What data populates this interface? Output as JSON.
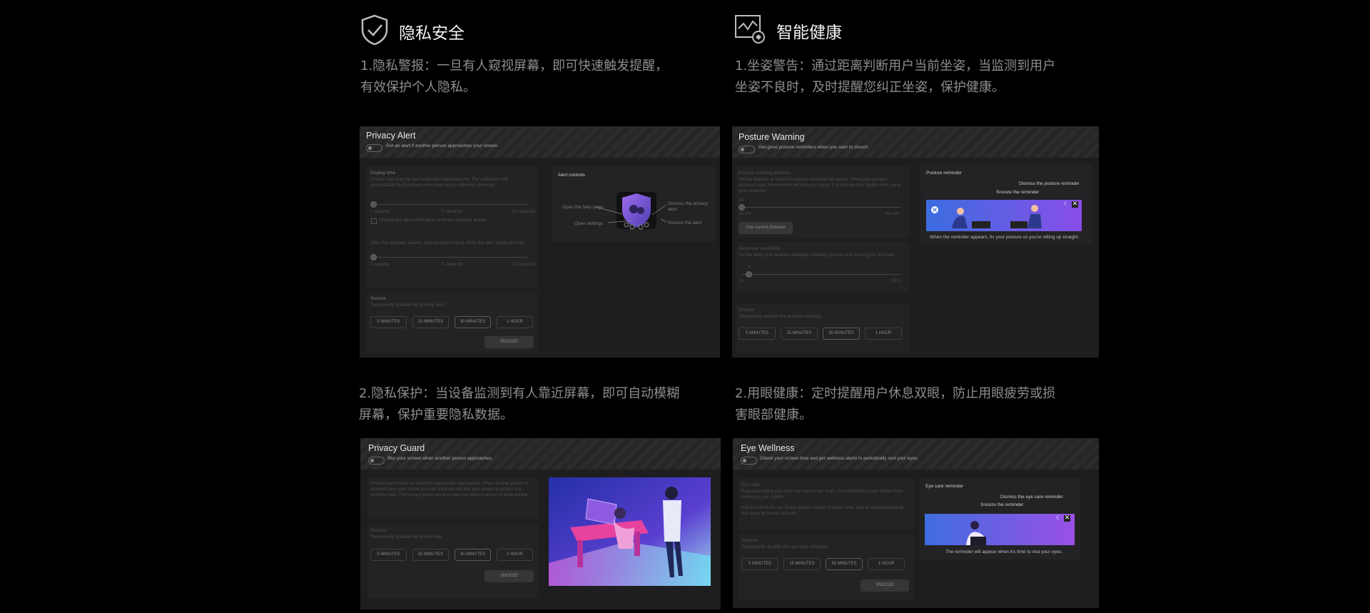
{
  "left_section": {
    "title": "隐私安全",
    "icon": "shield-check-icon",
    "desc1_line1": "1.隐私警报：一旦有人窥视屏幕，即可快速触发提醒，",
    "desc1_line2": "有效保护个人隐私。",
    "desc2_line1": "2.隐私保护：当设备监测到有人靠近屏幕，即可自动模糊",
    "desc2_line2": "屏幕，保护重要隐私数据。"
  },
  "right_section": {
    "title": "智能健康",
    "icon": "health-monitor-icon",
    "desc1_line1": "1.坐姿警告：通过距离判断用户当前坐姿，当监测到用户",
    "desc1_line2": "坐姿不良时，及时提醒您纠正坐姿，保护健康。",
    "desc2_line1": "2.用眼健康：定时提醒用户休息双眼，防止用眼疲劳或损",
    "desc2_line2": "害眼部健康。"
  },
  "privacy_alert": {
    "title": "Privacy Alert",
    "subtitle": "Get an alert if another person approaches your screen.",
    "display_time": "Display time",
    "display_time_desc": "Choose how long the alert notification will display for. The notification will automatically be dismissed when there are no onlookers detected.",
    "min_label": "1 second",
    "mid_label": "5 seconds",
    "max_label": "10 seconds",
    "checkbox_label": "Display the alert notification until the onlooker leaves",
    "after_leaves": "After the onlooker leaves, choose how long to show the alert notification for",
    "min_label2": "1 second",
    "mid_label2": "5 seconds",
    "max_label2": "10 seconds",
    "snooze": "Snooze",
    "snooze_desc": "Temporarily disable the privacy alert.",
    "btn_5": "5 MINUTES",
    "btn_15": "15 MINUTES",
    "btn_30": "30 MINUTES",
    "btn_1h": "1 HOUR",
    "snooze_btn": "SNOOZE",
    "alert_controls": "Alert controls",
    "help_page": "Open the help page",
    "open_settings": "Open settings",
    "dismiss_alert": "Dismiss the privacy alert",
    "snooze_alert": "Snooze the alert"
  },
  "posture_warning": {
    "title": "Posture Warning",
    "subtitle": "Get good posture reminders when you start to slouch.",
    "distance": "Posture warning distance",
    "distance_desc": "Set the distance at which the posture reminder will appear. When your posture becomes poor, the reminder will help you correct it to improve your health when using your computer.",
    "dist_value": "30",
    "dist_min": "30 cm",
    "dist_max": "60 cm",
    "use_current": "Use current distance",
    "sensitivity": "Reminder sensitivity",
    "sensitivity_desc": "Set the delay time between detecting unhealthy posture and showing the reminder.",
    "sens_value": "3",
    "sens_min": "3 s",
    "sens_max": "150 s",
    "snooze": "Snooze",
    "snooze_desc": "Temporarily disable the posture warning.",
    "btn_5": "5 MINUTES",
    "btn_15": "15 MINUTES",
    "btn_30": "30 MINUTES",
    "btn_1h": "1 HOUR",
    "reminder_title": "Posture reminder",
    "dismiss_reminder": "Dismiss the posture reminder",
    "snooze_reminder": "Snooze the reminder",
    "reminder_caption": "When the reminder appears, fix your posture so you're sitting up straight."
  },
  "privacy_guard": {
    "title": "Privacy Guard",
    "subtitle": "Blur your screen when another person approaches.",
    "desc": "Protect your privacy by detecting anyone who approaches. When another person is detected near your screen you can automatically blur your screen to protect any sensitive data. The privacy guard can also warn you when a person is approaching.",
    "snooze": "Snooze",
    "snooze_desc": "Temporarily disable the screen blur.",
    "btn_5": "5 MINUTES",
    "btn_15": "15 MINUTES",
    "btn_30": "30 MINUTES",
    "btn_1h": "1 HOUR",
    "snooze_btn": "SNOOZE"
  },
  "eye_wellness": {
    "title": "Eye Wellness",
    "subtitle": "Check your screen time and get wellness alerts to periodically rest your eyes.",
    "eye_care": "Eye care",
    "eye_care_desc": "Regularly resting your eyes can reduce eye strain. Get reminders to take breaks from looking at your screen.",
    "rule_desc": "Use the 20-20-20 rule. Every twenty minutes of screen time, look at something twenty feet away for twenty seconds.",
    "snooze": "Snooze",
    "snooze_desc": "Temporarily disable the eye care reminder.",
    "btn_5": "5 MINUTES",
    "btn_15": "15 MINUTES",
    "btn_30": "30 MINUTES",
    "btn_1h": "1 HOUR",
    "snooze_btn": "SNOOZE",
    "reminder_title": "Eye care reminder",
    "dismiss_reminder": "Dismiss the eye care reminder",
    "snooze_reminder": "Snooze the reminder",
    "reminder_caption": "The reminder will appear when it's time to rest your eyes."
  }
}
